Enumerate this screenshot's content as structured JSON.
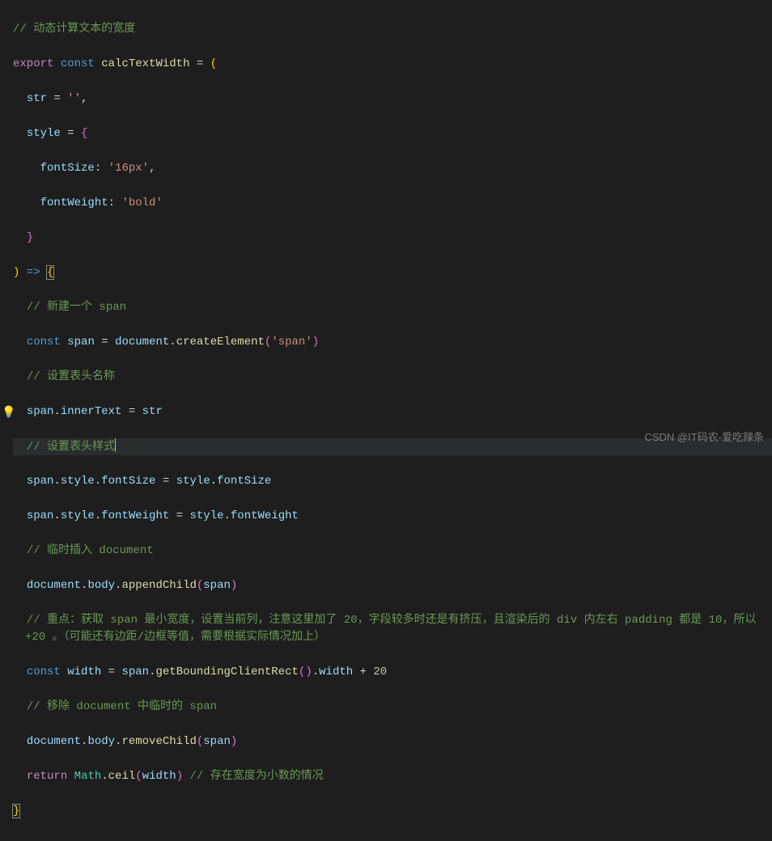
{
  "watermark": "CSDN @IT码农-爱吃辣条",
  "lines": {
    "l1_comment": "// 动态计算文本的宽度",
    "l2_export": "export",
    "l2_const": "const",
    "l2_func": "calcTextWidth",
    "l2_eq": " = ",
    "l3_str": "str",
    "l3_eq": " = ",
    "l3_val": "''",
    "l4_style": "style",
    "l4_eq": " = ",
    "l5_prop": "fontSize",
    "l5_val": "'16px'",
    "l6_prop": "fontWeight",
    "l6_val": "'bold'",
    "l8_arrow": " => ",
    "l9_comment": "// 新建一个 span",
    "l10_const": "const",
    "l10_span": "span",
    "l10_eq": " = ",
    "l10_doc": "document",
    "l10_method": "createElement",
    "l10_arg": "'span'",
    "l11_comment": "// 设置表头名称",
    "l12_span": "span",
    "l12_prop": "innerText",
    "l12_eq": " = ",
    "l12_str": "str",
    "l13_comment": "// 设置表头样式",
    "l14_span": "span",
    "l14_style": "style",
    "l14_prop": "fontSize",
    "l14_eq": " = ",
    "l14_rstyle": "style",
    "l14_rprop": "fontSize",
    "l15_span": "span",
    "l15_style": "style",
    "l15_prop": "fontWeight",
    "l15_eq": " = ",
    "l15_rstyle": "style",
    "l15_rprop": "fontWeight",
    "l16_comment": "// 临时插入 document",
    "l17_doc": "document",
    "l17_body": "body",
    "l17_method": "appendChild",
    "l17_arg": "span",
    "l18_comment": "// 重点：获取 span 最小宽度，设置当前列，注意这里加了 20，字段较多时还是有挤压，且渲染后的 div 内左右 padding 都是 10，所以 +20 。（可能还有边距/边框等值，需要根据实际情况加上）",
    "l19_const": "const",
    "l19_width": "width",
    "l19_eq": " = ",
    "l19_span": "span",
    "l19_method": "getBoundingClientRect",
    "l19_prop": "width",
    "l19_plus": " + ",
    "l19_num": "20",
    "l20_comment": "// 移除 document 中临时的 span",
    "l21_doc": "document",
    "l21_body": "body",
    "l21_method": "removeChild",
    "l21_arg": "span",
    "l22_return": "return",
    "l22_math": "Math",
    "l22_method": "ceil",
    "l22_arg": "width",
    "l22_comment": "// 存在宽度为小数的情况"
  }
}
